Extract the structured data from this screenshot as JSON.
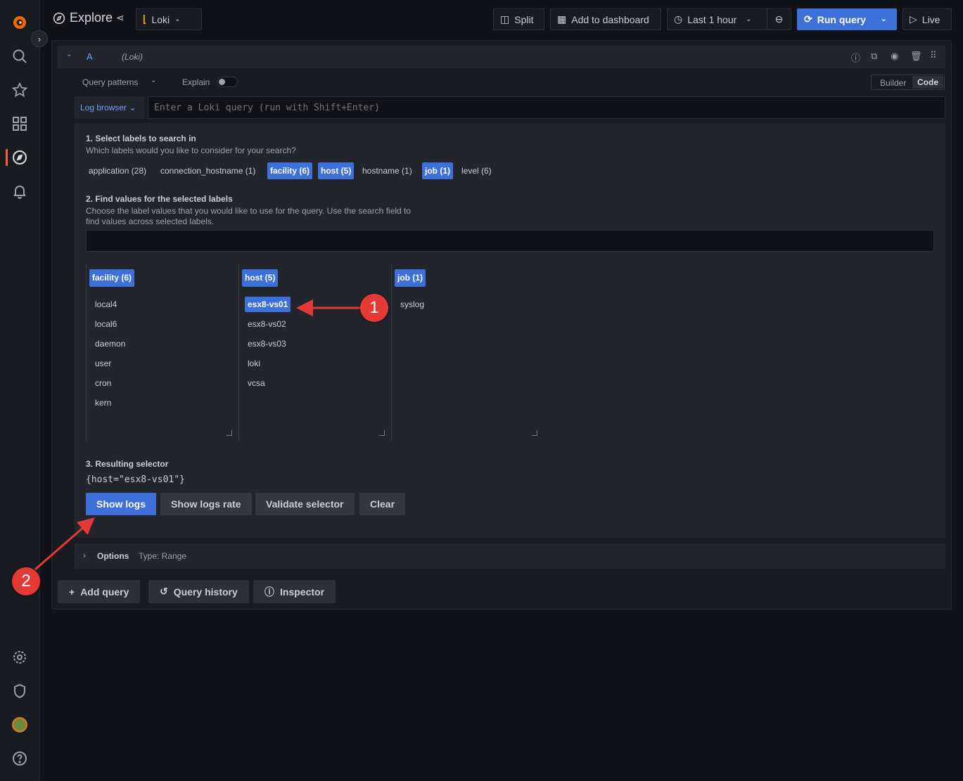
{
  "header": {
    "title": "Explore",
    "datasource": "Loki",
    "split": "Split",
    "add_to_dashboard": "Add to dashboard",
    "time_range": "Last 1 hour",
    "run_query": "Run query",
    "live": "Live"
  },
  "query": {
    "ref": "A",
    "datasource_hint": "(Loki)",
    "query_patterns": "Query patterns",
    "explain": "Explain",
    "builder": "Builder",
    "code": "Code",
    "log_browser": "Log browser",
    "placeholder": "Enter a Loki query (run with Shift+Enter)"
  },
  "browser": {
    "step1_title": "1. Select labels to search in",
    "step1_desc": "Which labels would you like to consider for your search?",
    "labels": [
      {
        "label": "application (28)",
        "selected": false
      },
      {
        "label": "connection_hostname (1)",
        "selected": false
      },
      {
        "label": "facility (6)",
        "selected": true
      },
      {
        "label": "host (5)",
        "selected": true
      },
      {
        "label": "hostname (1)",
        "selected": false
      },
      {
        "label": "job (1)",
        "selected": true
      },
      {
        "label": "level (6)",
        "selected": false
      }
    ],
    "step2_title": "2. Find values for the selected labels",
    "step2_desc_1": "Choose the label values that you would like to use for the query. Use the search field to",
    "step2_desc_2": "find values across selected labels.",
    "columns": [
      {
        "header": "facility (6)",
        "values": [
          "local4",
          "local6",
          "daemon",
          "user",
          "cron",
          "kern"
        ]
      },
      {
        "header": "host (5)",
        "values": [
          "esx8-vs01",
          "esx8-vs02",
          "esx8-vs03",
          "loki",
          "vcsa"
        ],
        "selected": "esx8-vs01"
      },
      {
        "header": "job (1)",
        "values": [
          "syslog"
        ]
      }
    ],
    "step3_title": "3. Resulting selector",
    "selector": "{host=\"esx8-vs01\"}",
    "show_logs": "Show logs",
    "show_logs_rate": "Show logs rate",
    "validate": "Validate selector",
    "clear": "Clear"
  },
  "options": {
    "label": "Options",
    "type": "Type: Range"
  },
  "footer": {
    "add_query": "Add query",
    "query_history": "Query history",
    "inspector": "Inspector"
  },
  "annotations": {
    "one": "1",
    "two": "2"
  },
  "colors": {
    "accent": "#3d71d9",
    "annotation": "#e53935"
  }
}
